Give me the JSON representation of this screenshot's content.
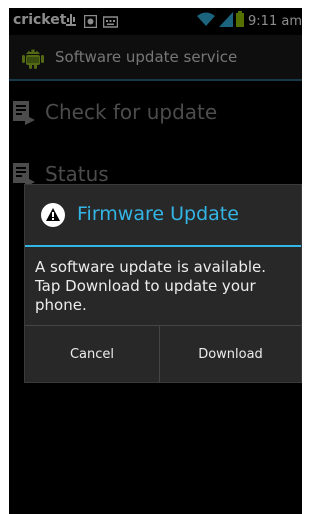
{
  "status_bar": {
    "carrier": "cricket",
    "time": "9:11 am",
    "icons": [
      "usb-icon",
      "screenshot-icon",
      "keyboard-icon",
      "wifi-icon",
      "signal-icon",
      "battery-icon"
    ]
  },
  "action_bar": {
    "title": "Software update service",
    "icon": "android-icon"
  },
  "list": {
    "items": [
      {
        "label": "Check for update",
        "icon": "document-icon"
      },
      {
        "label": "Status",
        "icon": "document-icon"
      }
    ]
  },
  "dialog": {
    "title": "Firmware Update",
    "icon": "warning-icon",
    "message": "A software update is available. Tap Download to update your phone.",
    "buttons": {
      "cancel": "Cancel",
      "download": "Download"
    }
  },
  "colors": {
    "accent": "#33b5e5",
    "background": "#000000",
    "dialog_background": "#282828"
  }
}
